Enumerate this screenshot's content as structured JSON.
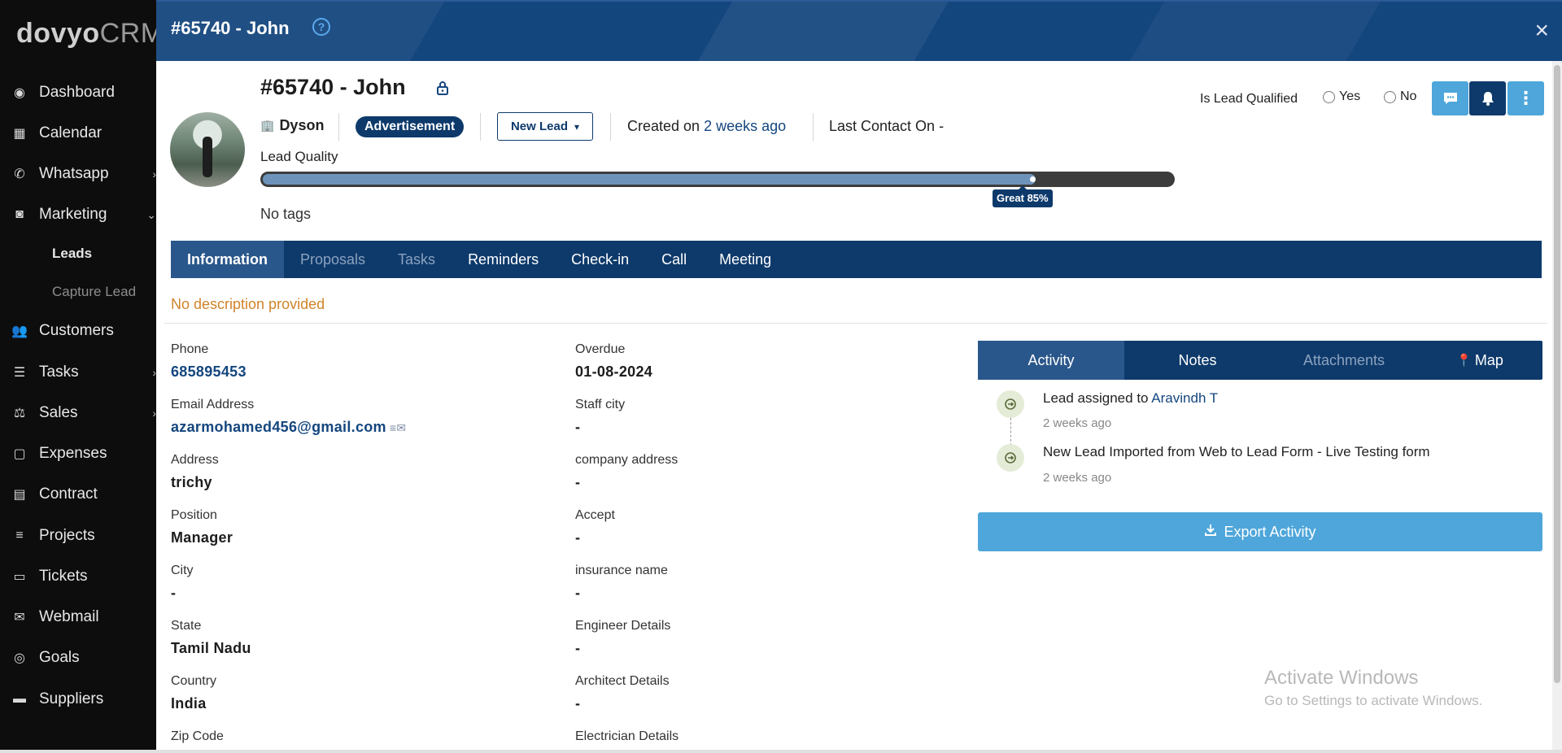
{
  "app": {
    "logo_main": "dovyo",
    "logo_suffix": "CRM"
  },
  "sidebar": {
    "items": [
      {
        "label": "Dashboard",
        "icon": "palette-icon"
      },
      {
        "label": "Calendar",
        "icon": "calendar-icon"
      },
      {
        "label": "Whatsapp",
        "icon": "whatsapp-icon",
        "chevron": "right"
      },
      {
        "label": "Marketing",
        "icon": "megaphone-icon",
        "chevron": "down"
      },
      {
        "label": "Customers",
        "icon": "users-icon"
      },
      {
        "label": "Tasks",
        "icon": "list-icon",
        "chevron": "right"
      },
      {
        "label": "Sales",
        "icon": "scale-icon",
        "chevron": "right"
      },
      {
        "label": "Expenses",
        "icon": "receipt-icon"
      },
      {
        "label": "Contract",
        "icon": "file-icon"
      },
      {
        "label": "Projects",
        "icon": "bars-icon"
      },
      {
        "label": "Tickets",
        "icon": "ticket-icon"
      },
      {
        "label": "Webmail",
        "icon": "envelope-icon"
      },
      {
        "label": "Goals",
        "icon": "target-icon"
      },
      {
        "label": "Suppliers",
        "icon": "truck-icon"
      }
    ],
    "sub_items": [
      {
        "label": "Leads",
        "active": true
      },
      {
        "label": "Capture Lead",
        "active": false
      }
    ]
  },
  "modal": {
    "title": "#65740 - John",
    "help_icon": "?",
    "close_icon": "×"
  },
  "lead": {
    "name": "#65740 - John",
    "company": "Dyson",
    "source": "Advertisement",
    "status": "New Lead",
    "created_prefix": "Created on",
    "created_ago": "2 weeks ago",
    "last_contact": "Last Contact On -",
    "quality_label": "Lead Quality",
    "quality_percent": 85,
    "quality_tip": "Great 85%",
    "tags": "No tags"
  },
  "qualified": {
    "label": "Is Lead Qualified",
    "yes": "Yes",
    "no": "No"
  },
  "tabs": [
    {
      "label": "Information",
      "state": "active"
    },
    {
      "label": "Proposals",
      "state": "disabled"
    },
    {
      "label": "Tasks",
      "state": "disabled"
    },
    {
      "label": "Reminders",
      "state": "normal"
    },
    {
      "label": "Check-in",
      "state": "normal"
    },
    {
      "label": "Call",
      "state": "normal"
    },
    {
      "label": "Meeting",
      "state": "normal"
    }
  ],
  "description": "No description provided",
  "fields_left": [
    {
      "label": "Phone",
      "value": "685895453",
      "link": true
    },
    {
      "label": "Email Address",
      "value": "azarmohamed456@gmail.com",
      "link": true,
      "mail": true
    },
    {
      "label": "Address",
      "value": "trichy"
    },
    {
      "label": "Position",
      "value": "Manager"
    },
    {
      "label": "City",
      "value": "-"
    },
    {
      "label": "State",
      "value": "Tamil Nadu"
    },
    {
      "label": "Country",
      "value": "India"
    },
    {
      "label": "Zip Code",
      "value": ""
    }
  ],
  "fields_right": [
    {
      "label": "Overdue",
      "value": "01-08-2024"
    },
    {
      "label": "Staff city",
      "value": "-"
    },
    {
      "label": "company address",
      "value": "-"
    },
    {
      "label": "Accept",
      "value": "-"
    },
    {
      "label": "insurance name",
      "value": "-"
    },
    {
      "label": "Engineer Details",
      "value": "-"
    },
    {
      "label": "Architect Details",
      "value": "-"
    },
    {
      "label": "Electrician Details",
      "value": ""
    }
  ],
  "side_tabs": [
    {
      "label": "Activity",
      "state": "active"
    },
    {
      "label": "Notes",
      "state": "normal"
    },
    {
      "label": "Attachments",
      "state": "disabled"
    },
    {
      "label": "Map",
      "state": "normal"
    }
  ],
  "activity": [
    {
      "text": "Lead assigned to",
      "who": "Aravindh T",
      "time": "2 weeks ago"
    },
    {
      "text": "New Lead Imported from Web to Lead Form - Live Testing form",
      "who": "",
      "time": "2 weeks ago"
    }
  ],
  "export_label": "Export Activity",
  "watermark": {
    "title": "Activate Windows",
    "subtitle": "Go to Settings to activate Windows."
  }
}
